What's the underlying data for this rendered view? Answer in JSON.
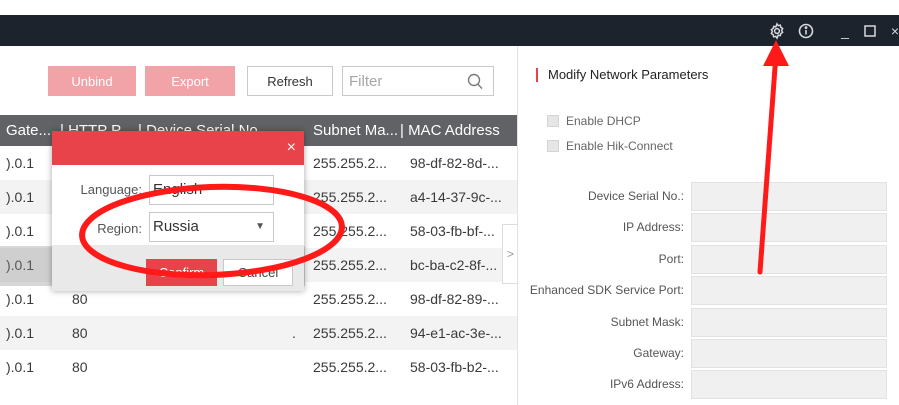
{
  "toolbar": {
    "unbind": "Unbind",
    "export": "Export",
    "refresh": "Refresh",
    "filter_placeholder": "Filter"
  },
  "table": {
    "headers": {
      "gateway": "Gate...",
      "http": "| HTTP P...",
      "serial": "| Device Serial No...",
      "subnet": "Subnet Ma...",
      "mac": "| MAC Address"
    },
    "rows": [
      {
        "gateway": ").0.1",
        "http": "",
        "serial": "",
        "subnet": "255.255.2...",
        "mac": "98-df-82-8d-..."
      },
      {
        "gateway": ").0.1",
        "http": "",
        "serial": "",
        "subnet": "255.255.2...",
        "mac": "a4-14-37-9c-..."
      },
      {
        "gateway": ").0.1",
        "http": "",
        "serial": "",
        "subnet": "255.255.2...",
        "mac": "58-03-fb-bf-..."
      },
      {
        "gateway": ").0.1",
        "http": "",
        "serial": "",
        "subnet": "255.255.2...",
        "mac": "bc-ba-c2-8f-..."
      },
      {
        "gateway": ").0.1",
        "http": "80",
        "serial": "",
        "subnet": "255.255.2...",
        "mac": "98-df-82-89-..."
      },
      {
        "gateway": ").0.1",
        "http": "80",
        "serial": ".",
        "subnet": "255.255.2...",
        "mac": "94-e1-ac-3e-..."
      },
      {
        "gateway": ").0.1",
        "http": "80",
        "serial": "",
        "subnet": "255.255.2...",
        "mac": "58-03-fb-b2-..."
      }
    ]
  },
  "dialog": {
    "language_label": "Language:",
    "language_value": "English",
    "region_label": "Region:",
    "region_value": "Russia",
    "confirm": "Confirm",
    "cancel": "Cancel"
  },
  "panel": {
    "title": "Modify Network Parameters",
    "enable_dhcp": "Enable DHCP",
    "enable_hik": "Enable Hik-Connect",
    "fields": {
      "serial": "Device Serial No.:",
      "ip": "IP Address:",
      "port": "Port:",
      "sdk_port": "Enhanced SDK Service Port:",
      "subnet": "Subnet Mask:",
      "gateway": "Gateway:",
      "ipv6": "IPv6 Address:"
    }
  },
  "titlebar": {
    "minimize": "_",
    "close": "×"
  },
  "icons": {
    "gear": "gear-icon",
    "info": "info-icon",
    "search": "search-icon"
  },
  "colors": {
    "accent": "#e8424b",
    "annotation": "#ff1a1a",
    "titlebar": "#1d232c",
    "table_header": "#616266"
  }
}
